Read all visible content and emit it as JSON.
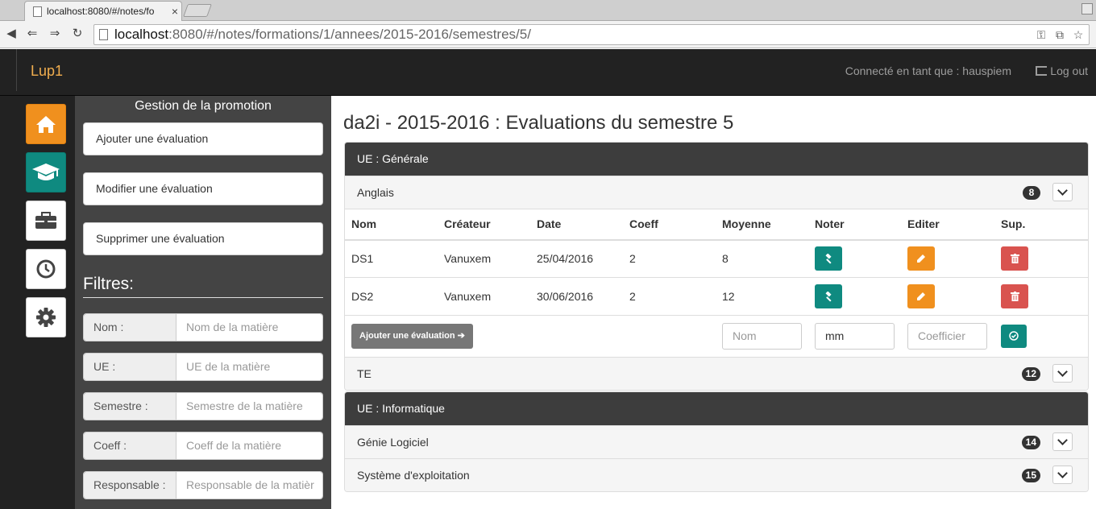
{
  "browser": {
    "tab_title": "localhost:8080/#/notes/fo",
    "tab_close": "×",
    "url_host": "localhost",
    "url_rest": ":8080/#/notes/formations/1/annees/2015-2016/semestres/5/"
  },
  "navbar": {
    "brand": "Lup1",
    "connected": "Connecté en tant que : hauspiem",
    "logout": "Log out"
  },
  "icons": [
    "home-icon",
    "graduation-cap-icon",
    "briefcase-icon",
    "clock-icon",
    "gear-icon"
  ],
  "sidebar": {
    "title": "Gestion de la promotion",
    "actions": [
      "Ajouter une évaluation",
      "Modifier une évaluation",
      "Supprimer une évaluation"
    ],
    "filters_title": "Filtres:",
    "filters": [
      {
        "label": "Nom :",
        "placeholder": "Nom de la matière"
      },
      {
        "label": "UE :",
        "placeholder": "UE de la matière"
      },
      {
        "label": "Semestre :",
        "placeholder": "Semestre de la matière"
      },
      {
        "label": "Coeff :",
        "placeholder": "Coeff de la matière"
      },
      {
        "label": "Responsable :",
        "placeholder": "Responsable de la matièr"
      }
    ]
  },
  "main": {
    "title": "da2i - 2015-2016 : Evaluations du semestre 5",
    "ue_generale": {
      "heading": "UE : Générale",
      "anglais": {
        "name": "Anglais",
        "count": "8"
      },
      "columns": [
        "Nom",
        "Créateur",
        "Date",
        "Coeff",
        "Moyenne",
        "Noter",
        "Editer",
        "Sup."
      ],
      "rows": [
        {
          "nom": "DS1",
          "createur": "Vanuxem",
          "date": "25/04/2016",
          "coeff": "2",
          "moyenne": "8"
        },
        {
          "nom": "DS2",
          "createur": "Vanuxem",
          "date": "30/06/2016",
          "coeff": "2",
          "moyenne": "12"
        }
      ],
      "add_button": "Ajouter une évaluation ➔",
      "add_inputs": {
        "nom_placeholder": "Nom",
        "date_value": "mm",
        "coeff_placeholder": "Coefficier"
      },
      "te": {
        "name": "TE",
        "count": "12"
      }
    },
    "ue_informatique": {
      "heading": "UE : Informatique",
      "items": [
        {
          "name": "Génie Logiciel",
          "count": "14"
        },
        {
          "name": "Système d'exploitation",
          "count": "15"
        }
      ]
    }
  },
  "colors": {
    "accent_orange": "#f0901e",
    "accent_teal": "#0f8a80",
    "danger": "#d9534f",
    "dark": "#222222"
  }
}
